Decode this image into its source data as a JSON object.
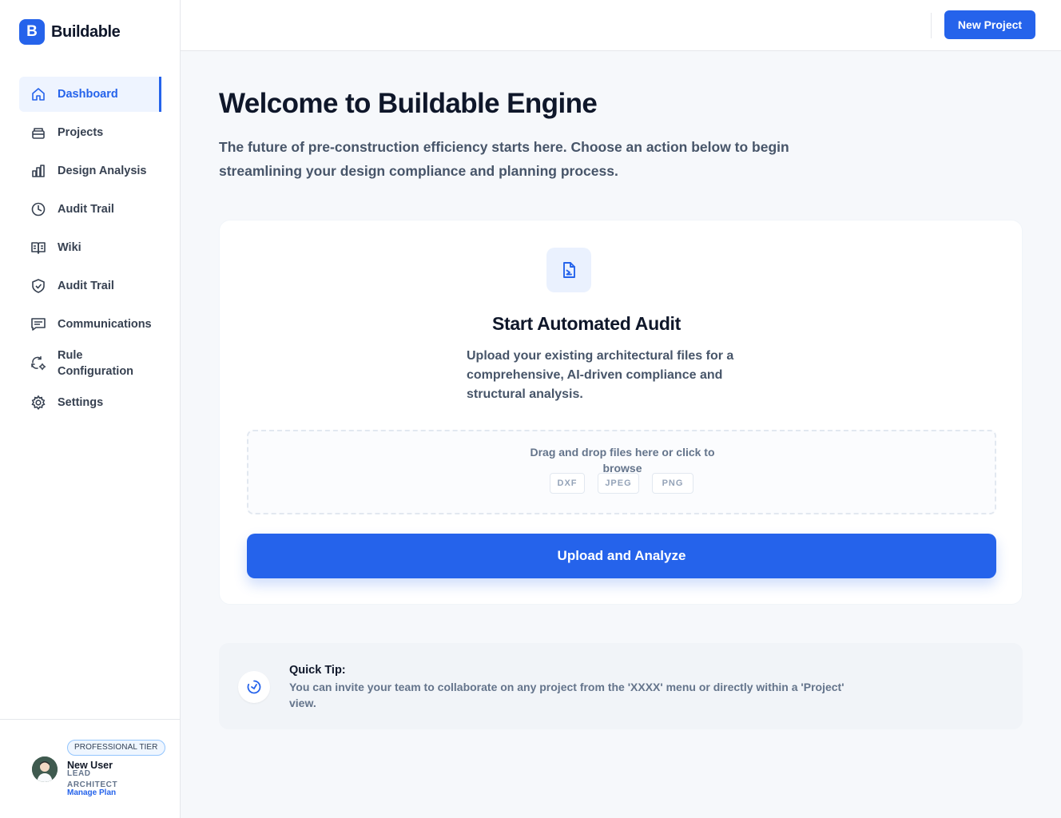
{
  "brand": {
    "initial": "B",
    "name": "Buildable"
  },
  "nav": {
    "items": [
      {
        "label": "Dashboard",
        "icon": "home-icon",
        "active": true
      },
      {
        "label": "Projects",
        "icon": "folder-icon"
      },
      {
        "label": "Design Analysis",
        "icon": "bar-chart-icon"
      },
      {
        "label": "Audit Trail",
        "icon": "pie-clock-icon"
      },
      {
        "label": "Wiki",
        "icon": "book-icon"
      },
      {
        "label": "Audit Trail",
        "icon": "shield-check-icon"
      },
      {
        "label": "Communications",
        "icon": "message-icon"
      },
      {
        "label": "Rule Configuration",
        "icon": "sync-gear-icon"
      },
      {
        "label": "Settings",
        "icon": "gear-icon"
      }
    ]
  },
  "user": {
    "tier": "PROFESSIONAL TIER",
    "name": "New User",
    "role": "LEAD ARCHITECT",
    "manage_plan": "Manage Plan"
  },
  "topbar": {
    "new_project_label": "New Project"
  },
  "main": {
    "title": "Welcome to Buildable Engine",
    "subtitle": "The future of pre-construction efficiency starts here. Choose an action below to begin streamlining your design compliance and planning process."
  },
  "audit_card": {
    "title": "Start Automated Audit",
    "description": "Upload your existing architectural files for a comprehensive, AI-driven compliance and structural analysis.",
    "dropzone_text": "Drag and drop files here or click to browse",
    "formats": [
      "DXF",
      "JPEG",
      "PNG"
    ],
    "upload_label": "Upload and Analyze"
  },
  "tip": {
    "title": "Quick Tip:",
    "text": "You can invite your team to collaborate on any project from the 'XXXX' menu or directly within a 'Project' view."
  },
  "colors": {
    "accent": "#2563eb",
    "accent_soft": "#eef4ff",
    "text": "#0f172a",
    "muted": "#475569"
  }
}
